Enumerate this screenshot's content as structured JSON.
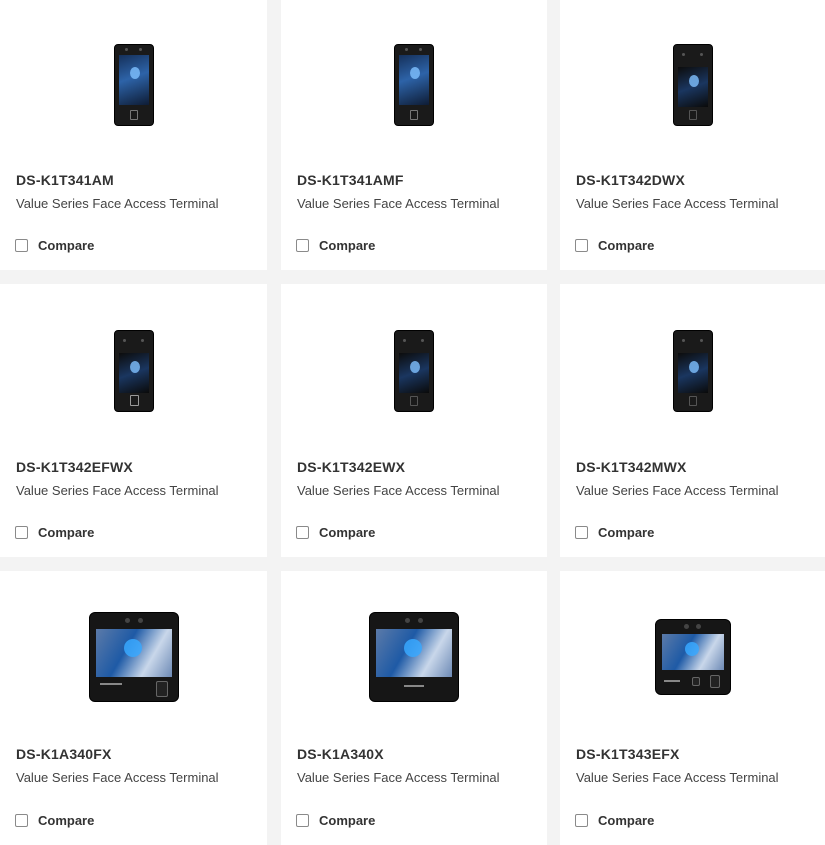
{
  "compare_label": "Compare",
  "products": [
    {
      "model": "DS-K1T341AM",
      "subtitle": "Value Series Face Access Terminal",
      "image": "tall-face-terminal-with-fingerprint"
    },
    {
      "model": "DS-K1T341AMF",
      "subtitle": "Value Series Face Access Terminal",
      "image": "tall-face-terminal-with-fingerprint"
    },
    {
      "model": "DS-K1T342DWX",
      "subtitle": "Value Series Face Access Terminal",
      "image": "tall-dark-face-terminal"
    },
    {
      "model": "DS-K1T342EFWX",
      "subtitle": "Value Series Face Access Terminal",
      "image": "tall-dark-face-terminal-with-card-reader"
    },
    {
      "model": "DS-K1T342EWX",
      "subtitle": "Value Series Face Access Terminal",
      "image": "tall-dark-face-terminal"
    },
    {
      "model": "DS-K1T342MWX",
      "subtitle": "Value Series Face Access Terminal",
      "image": "tall-dark-face-terminal"
    },
    {
      "model": "DS-K1A340FX",
      "subtitle": "Value Series Face Access Terminal",
      "image": "square-face-terminal-with-fingerprint"
    },
    {
      "model": "DS-K1A340X",
      "subtitle": "Value Series Face Access Terminal",
      "image": "square-face-terminal"
    },
    {
      "model": "DS-K1T343EFX",
      "subtitle": "Value Series Face Access Terminal",
      "image": "square-face-terminal-with-card-and-fingerprint"
    }
  ]
}
